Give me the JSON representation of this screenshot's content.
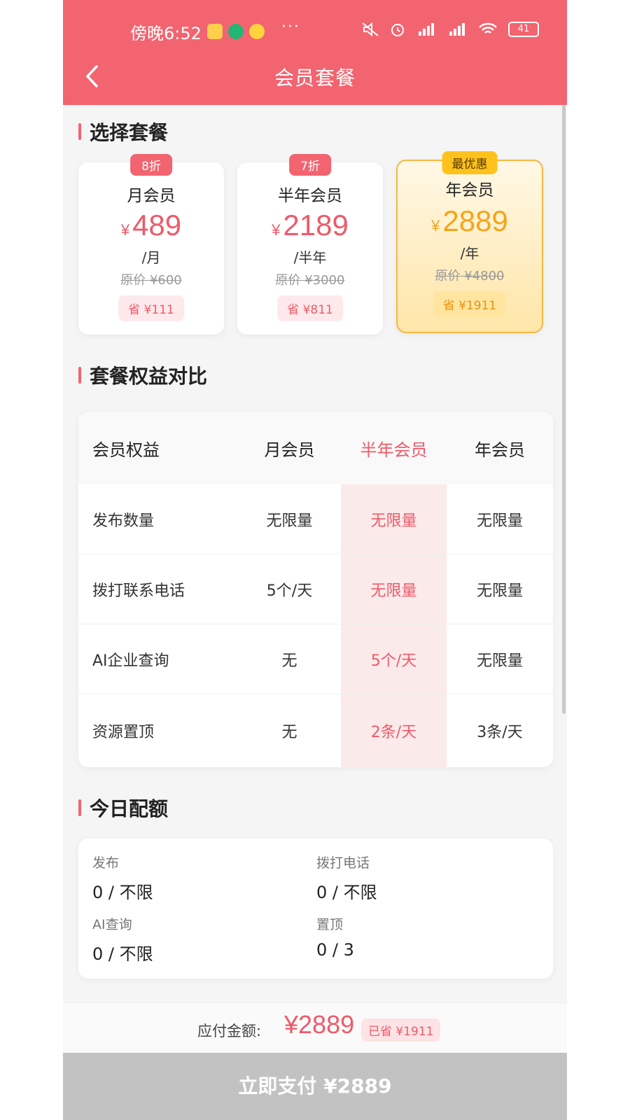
{
  "status_bar": {
    "time": "傍晚6:52",
    "battery": "41"
  },
  "header": {
    "title": "会员套餐"
  },
  "sections": {
    "choose": "选择套餐",
    "compare": "套餐权益对比",
    "quota": "今日配额"
  },
  "plans": [
    {
      "tag": "8折",
      "name": "月会员",
      "yen": "¥",
      "price": "489",
      "unit": "/月",
      "original": "原价 ¥600",
      "save": "省 ¥111"
    },
    {
      "tag": "7折",
      "name": "半年会员",
      "yen": "¥",
      "price": "2189",
      "unit": "/半年",
      "original": "原价 ¥3000",
      "save": "省 ¥811"
    },
    {
      "tag": "最优惠",
      "name": "年会员",
      "yen": "¥",
      "price": "2889",
      "unit": "/年",
      "original": "原价 ¥4800",
      "save": "省 ¥1911"
    }
  ],
  "comparison": {
    "headers": [
      "会员权益",
      "月会员",
      "半年会员",
      "年会员"
    ],
    "rows": [
      [
        "发布数量",
        "无限量",
        "无限量",
        "无限量"
      ],
      [
        "拨打联系电话",
        "5个/天",
        "无限量",
        "无限量"
      ],
      [
        "AI企业查询",
        "无",
        "5个/天",
        "无限量"
      ],
      [
        "资源置顶",
        "无",
        "2条/天",
        "3条/天"
      ]
    ]
  },
  "quota": [
    {
      "label": "发布",
      "value": "0 / 不限"
    },
    {
      "label": "拨打电话",
      "value": "0 / 不限"
    },
    {
      "label": "AI查询",
      "value": "0 / 不限"
    },
    {
      "label": "置顶",
      "value": "0 / 3"
    }
  ],
  "footer": {
    "label": "应付金额:",
    "amount": "¥2889",
    "saved": "已省 ¥1911",
    "pay_button": "立即支付 ¥2889"
  },
  "colors": {
    "brand": "#f26470",
    "price": "#ee5a69",
    "gold": "#f6a418"
  }
}
